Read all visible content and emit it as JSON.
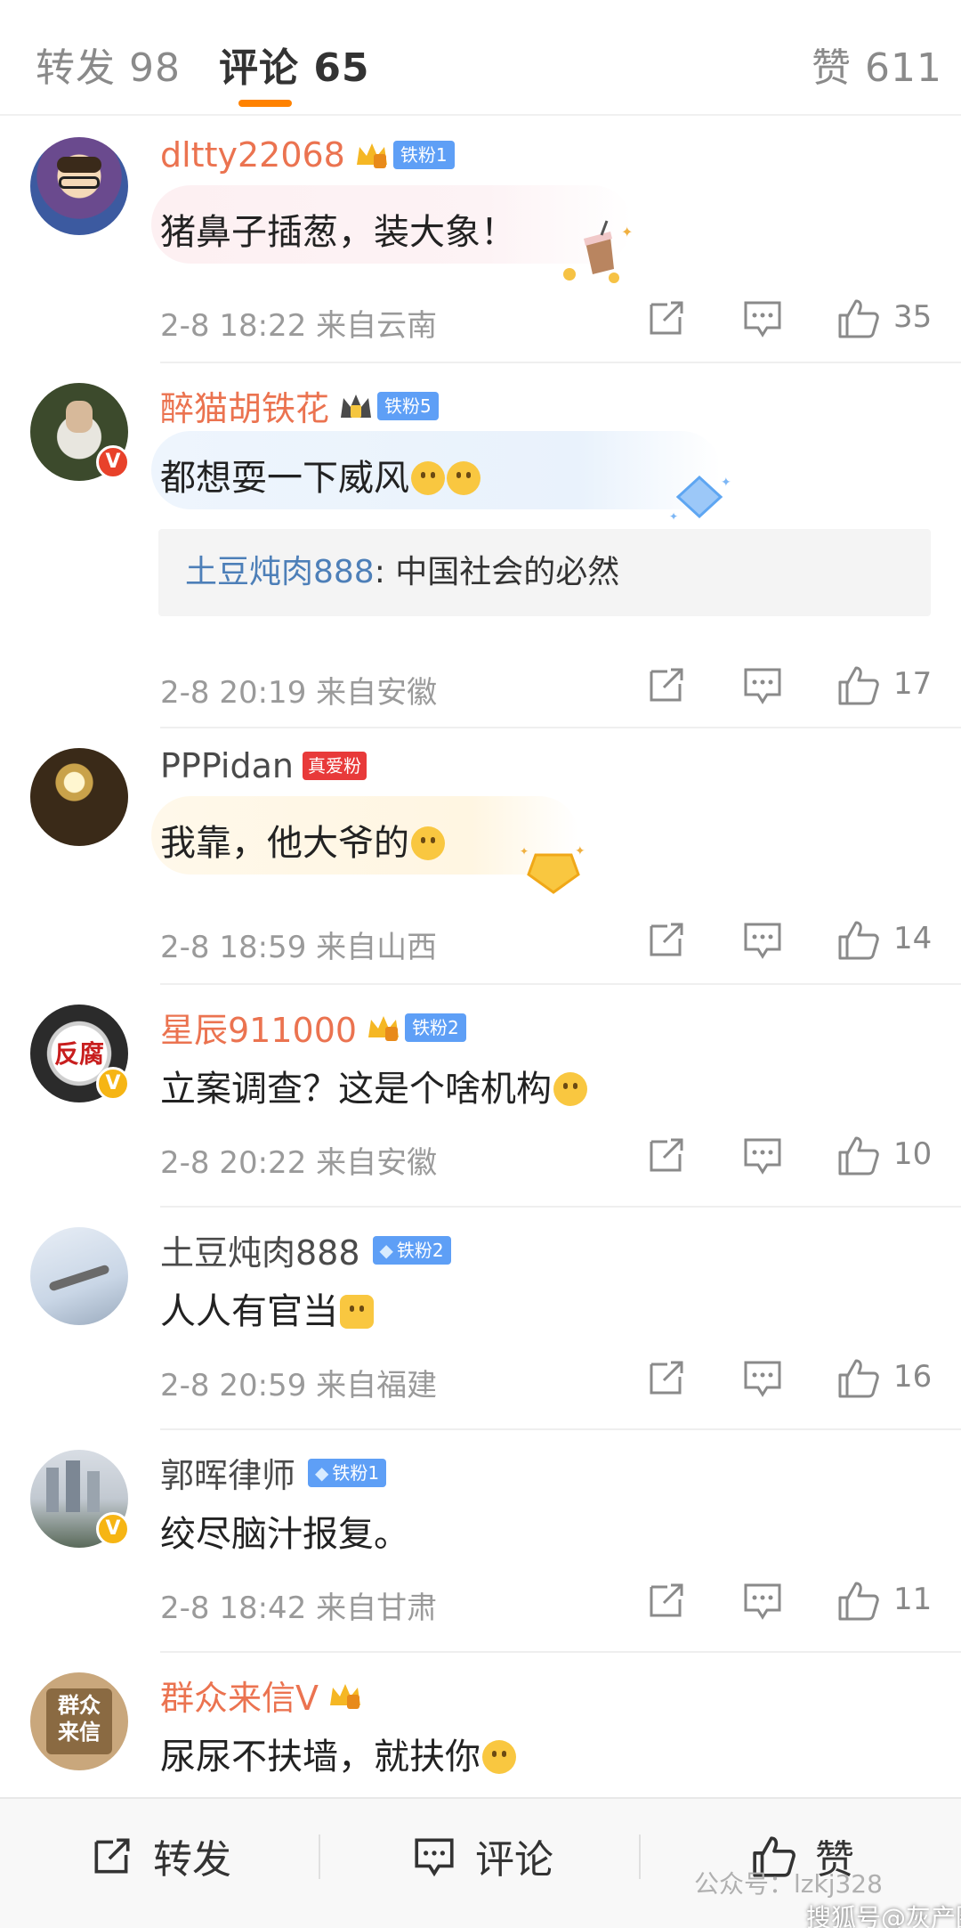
{
  "tabs": {
    "repost": "转发 98",
    "comments": "评论 65",
    "likes": "赞 611"
  },
  "comments": [
    {
      "user": "dltty22068",
      "fan_badge": "铁粉1",
      "text": "猪鼻子插葱，装大象！",
      "time": "2-8 18:22",
      "location": "来自云南",
      "likes": "35"
    },
    {
      "user": "醉猫胡铁花",
      "fan_badge": "铁粉5",
      "text": "都想耍一下威风",
      "quote_user": "土豆炖肉888",
      "quote_text": ": 中国社会的必然",
      "time": "2-8 20:19",
      "location": "来自安徽",
      "likes": "17"
    },
    {
      "user": "PPPidan",
      "fan_badge": "真爱粉",
      "text": "我靠，他大爷的",
      "time": "2-8 18:59",
      "location": "来自山西",
      "likes": "14"
    },
    {
      "user": "星辰911000",
      "fan_badge": "铁粉2",
      "avatar_text": "反腐",
      "text": "立案调查？这是个啥机构",
      "time": "2-8 20:22",
      "location": "来自安徽",
      "likes": "10"
    },
    {
      "user": "土豆炖肉888",
      "fan_badge": "铁粉2",
      "text": "人人有官当",
      "time": "2-8 20:59",
      "location": "来自福建",
      "likes": "16"
    },
    {
      "user": "郭晖律师",
      "fan_badge": "铁粉1",
      "text": "绞尽脑汁报复。",
      "time": "2-8 18:42",
      "location": "来自甘肃",
      "likes": "11"
    },
    {
      "user": "群众来信V",
      "avatar_text": "群众来信",
      "text": "尿尿不扶墙，就扶你"
    }
  ],
  "bottom": {
    "repost": "转发",
    "comment": "评论",
    "like": "赞"
  },
  "watermark": {
    "wechat": "公众号：lzkj328",
    "sohu": "搜狐号@灰产圈"
  },
  "colors": {
    "accent": "#ff8200",
    "username_orange": "#eb7350",
    "quote_blue": "#4d7fb8",
    "fan_badge_blue": "#5e9ff6"
  }
}
